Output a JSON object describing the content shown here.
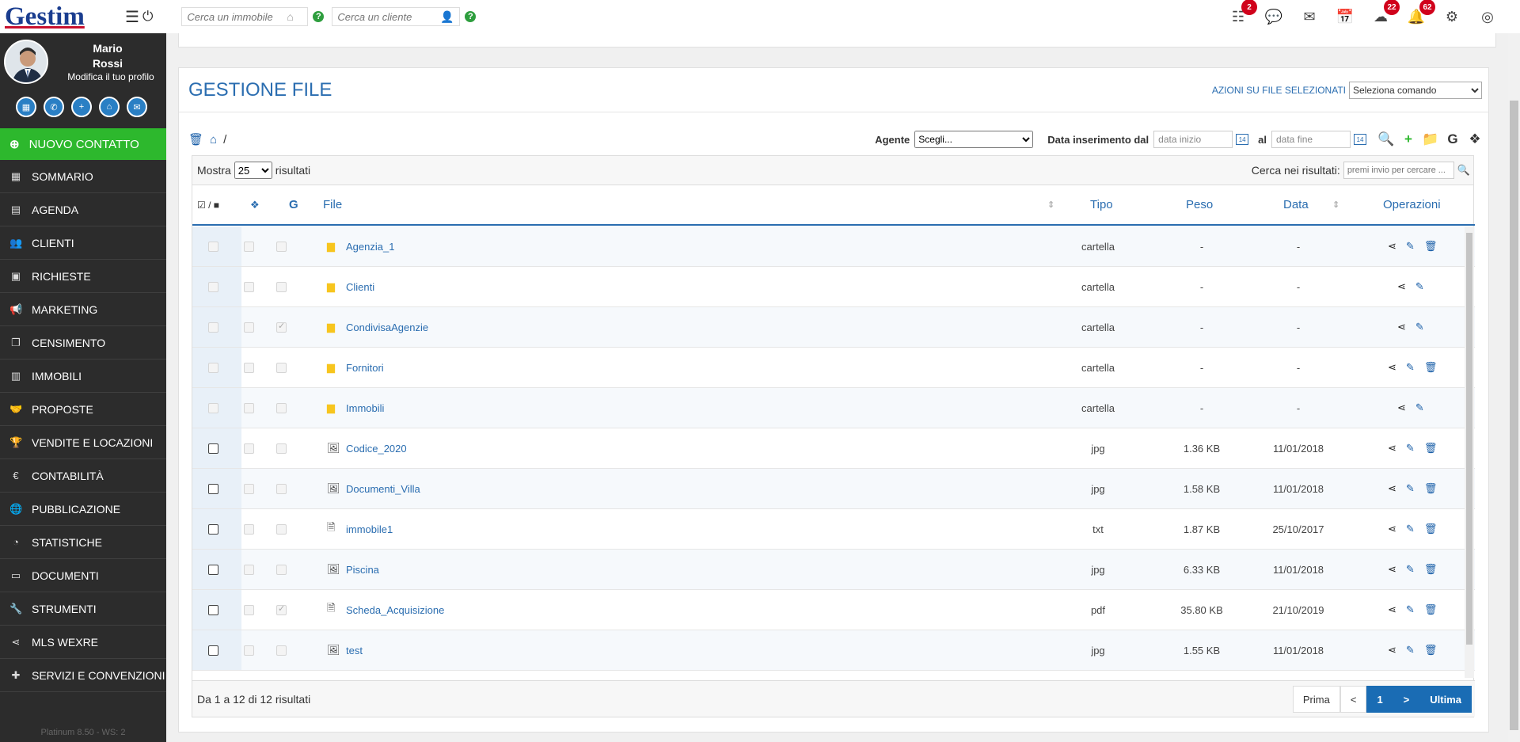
{
  "app": {
    "logo": "Gestim"
  },
  "topbar": {
    "search_property_placeholder": "Cerca un immobile",
    "search_client_placeholder": "Cerca un cliente",
    "help": "?",
    "badges": {
      "tasks": "2",
      "cloud": "22",
      "notifications": "62"
    }
  },
  "profile": {
    "first_name": "Mario",
    "last_name": "Rossi",
    "edit_label": "Modifica il tuo profilo"
  },
  "sidebar": {
    "new_contact": "NUOVO CONTATTO",
    "items": [
      {
        "label": "SOMMARIO",
        "icon": "grid-icon",
        "glyph": "▦"
      },
      {
        "label": "AGENDA",
        "icon": "calendar-icon",
        "glyph": "▤"
      },
      {
        "label": "CLIENTI",
        "icon": "users-icon",
        "glyph": "👥"
      },
      {
        "label": "RICHIESTE",
        "icon": "request-icon",
        "glyph": "▣"
      },
      {
        "label": "MARKETING",
        "icon": "megaphone-icon",
        "glyph": "📢"
      },
      {
        "label": "CENSIMENTO",
        "icon": "copy-icon",
        "glyph": "❐"
      },
      {
        "label": "IMMOBILI",
        "icon": "building-icon",
        "glyph": "▥"
      },
      {
        "label": "PROPOSTE",
        "icon": "handshake-icon",
        "glyph": "🤝"
      },
      {
        "label": "VENDITE E LOCAZIONI",
        "icon": "trophy-icon",
        "glyph": "🏆"
      },
      {
        "label": "CONTABILITÀ",
        "icon": "euro-icon",
        "glyph": "€"
      },
      {
        "label": "PUBBLICAZIONE",
        "icon": "globe-icon",
        "glyph": "🌐"
      },
      {
        "label": "STATISTICHE",
        "icon": "pie-chart-icon",
        "glyph": "◔"
      },
      {
        "label": "DOCUMENTI",
        "icon": "archive-icon",
        "glyph": "▭"
      },
      {
        "label": "STRUMENTI",
        "icon": "wrench-icon",
        "glyph": "🔧"
      },
      {
        "label": "MLS WEXRE",
        "icon": "share-icon",
        "glyph": "⋖"
      },
      {
        "label": "SERVIZI E CONVENZIONI",
        "icon": "puzzle-icon",
        "glyph": "✚"
      }
    ],
    "version": "Platinum 8.50 - WS: 2"
  },
  "panel": {
    "title": "GESTIONE FILE",
    "actions_label": "AZIONI SU FILE SELEZIONATI",
    "actions_select": "Seleziona comando",
    "path_sep": "/",
    "agent_label": "Agente",
    "agent_value": "Scegli...",
    "date_from_label": "Data inserimento dal",
    "date_from_placeholder": "data inizio",
    "date_to_label": "al",
    "date_to_placeholder": "data fine",
    "cal_label": "14"
  },
  "table": {
    "show_label": "Mostra",
    "show_value": "25",
    "results_label": "risultati",
    "search_label": "Cerca nei risultati:",
    "search_placeholder": "premi invio per cercare ...",
    "headers": {
      "select": "/",
      "file": "File",
      "tipo": "Tipo",
      "peso": "Peso",
      "data": "Data",
      "ops": "Operazioni",
      "google": "G"
    },
    "rows": [
      {
        "name": "Agenzia_1",
        "kind": "folder",
        "tipo": "cartella",
        "peso": "-",
        "data": "-",
        "g_checked": false,
        "delete": true
      },
      {
        "name": "Clienti",
        "kind": "folder",
        "tipo": "cartella",
        "peso": "-",
        "data": "-",
        "g_checked": false,
        "delete": false
      },
      {
        "name": "CondivisaAgenzie",
        "kind": "folder",
        "tipo": "cartella",
        "peso": "-",
        "data": "-",
        "g_checked": true,
        "delete": false
      },
      {
        "name": "Fornitori",
        "kind": "folder",
        "tipo": "cartella",
        "peso": "-",
        "data": "-",
        "g_checked": false,
        "delete": true
      },
      {
        "name": "Immobili",
        "kind": "folder",
        "tipo": "cartella",
        "peso": "-",
        "data": "-",
        "g_checked": false,
        "delete": false
      },
      {
        "name": "Codice_2020",
        "kind": "image",
        "tipo": "jpg",
        "peso": "1.36 KB",
        "data": "11/01/2018",
        "g_checked": false,
        "delete": true
      },
      {
        "name": "Documenti_Villa",
        "kind": "image",
        "tipo": "jpg",
        "peso": "1.58 KB",
        "data": "11/01/2018",
        "g_checked": false,
        "delete": true
      },
      {
        "name": "immobile1",
        "kind": "text",
        "tipo": "txt",
        "peso": "1.87 KB",
        "data": "25/10/2017",
        "g_checked": false,
        "delete": true
      },
      {
        "name": "Piscina",
        "kind": "image",
        "tipo": "jpg",
        "peso": "6.33 KB",
        "data": "11/01/2018",
        "g_checked": false,
        "delete": true
      },
      {
        "name": "Scheda_Acquisizione",
        "kind": "pdf",
        "tipo": "pdf",
        "peso": "35.80 KB",
        "data": "21/10/2019",
        "g_checked": true,
        "delete": true
      },
      {
        "name": "test",
        "kind": "image",
        "tipo": "jpg",
        "peso": "1.55 KB",
        "data": "11/01/2018",
        "g_checked": false,
        "delete": true
      }
    ],
    "footer_info": "Da 1 a 12 di 12 risultati",
    "pager": {
      "first": "Prima",
      "prev": "<",
      "current": "1",
      "next": ">",
      "last": "Ultima"
    }
  }
}
